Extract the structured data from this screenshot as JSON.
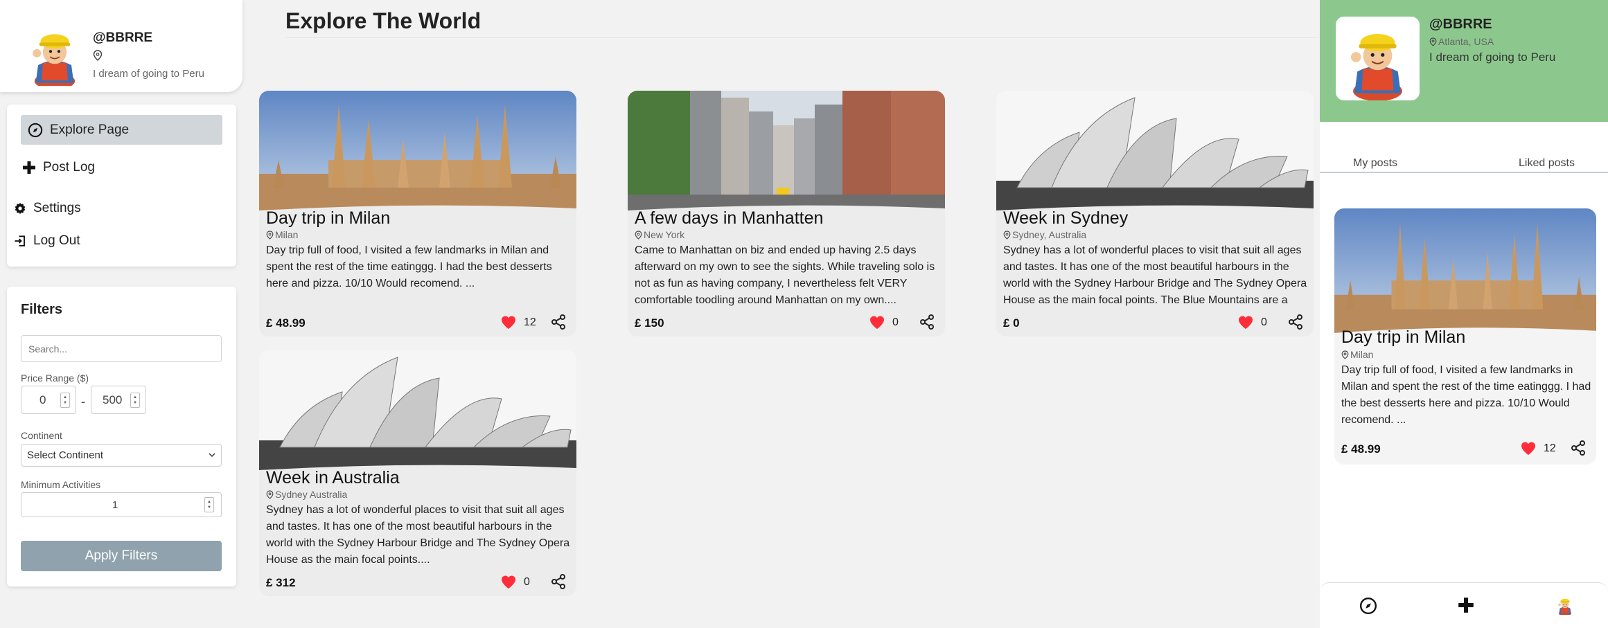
{
  "profile": {
    "handle": "@BBRRE",
    "location": "",
    "bio": "I dream of going to Peru"
  },
  "nav": {
    "items": [
      {
        "label": "Explore Page",
        "icon": "compass-icon"
      },
      {
        "label": "Post Log",
        "icon": "plus-icon"
      },
      {
        "label": "Settings",
        "icon": "gear-icon"
      },
      {
        "label": "Log Out",
        "icon": "logout-icon"
      }
    ]
  },
  "filters": {
    "title": "Filters",
    "search_placeholder": "Search...",
    "price_label": "Price Range ($)",
    "price_min": "0",
    "price_sep": "-",
    "price_max": "500",
    "continent_label": "Continent",
    "continent_value": "Select Continent",
    "min_activities_label": "Minimum Activities",
    "min_activities_value": "1",
    "apply_label": "Apply Filters"
  },
  "page": {
    "title": "Explore The World"
  },
  "posts": [
    {
      "title": "Day trip in Milan",
      "location": "Milan",
      "description": "Day trip full of food, I visited a few landmarks in Milan and spent the rest of the time eatinggg. I had the best desserts here and pizza. 10/10 Would recomend. ...",
      "price": "£ 48.99",
      "likes": "12",
      "image": "milan-cathedral"
    },
    {
      "title": "A few days in Manhatten",
      "location": "New York",
      "description": "Came to Manhattan on biz and ended up having 2.5 days afterward on my own to see the sights. While traveling solo is not as fun as having company, I nevertheless felt VERY comfortable toodling around Manhattan on my own....",
      "price": "£ 150",
      "likes": "0",
      "image": "manhattan-street"
    },
    {
      "title": "Week in Sydney",
      "location": "Sydney, Australia",
      "description": "Sydney has a lot of wonderful places to visit that suit all ages and tastes. It has one of the most beautiful harbours in the world with the Sydney Harbour Bridge and The Sydney Opera House as the main focal points. The Blue Mountains are a",
      "price": "£ 0",
      "likes": "0",
      "image": "sydney-opera-house"
    },
    {
      "title": "Week in Australia",
      "location": "Sydney Australia",
      "description": "Sydney has a lot of wonderful places to visit that suit all ages and tastes. It has one of the most beautiful harbours in the world with the Sydney Harbour Bridge and The Sydney Opera House as the main focal points....",
      "price": "£ 312",
      "likes": "0",
      "image": "sydney-opera-house"
    }
  ],
  "right_panel": {
    "handle": "@BBRRE",
    "location": "Atlanta, USA",
    "bio": "I dream of going to Peru",
    "tabs": [
      "My posts",
      "Liked posts"
    ],
    "post": {
      "title": "Day trip in Milan",
      "location": "Milan",
      "description": "Day trip full of food, I visited a few landmarks in Milan and spent the rest of the time eatinggg. I had the best desserts here and pizza. 10/10 Would recomend. ...",
      "price": "£ 48.99",
      "likes": "12"
    },
    "bottom_nav": [
      "compass-icon",
      "plus-icon",
      "avatar-icon"
    ]
  },
  "colors": {
    "heart": "#ff2d3a",
    "banner": "#8cc88e",
    "apply_button": "#8fa2ad",
    "active_nav": "#d0d6da"
  }
}
